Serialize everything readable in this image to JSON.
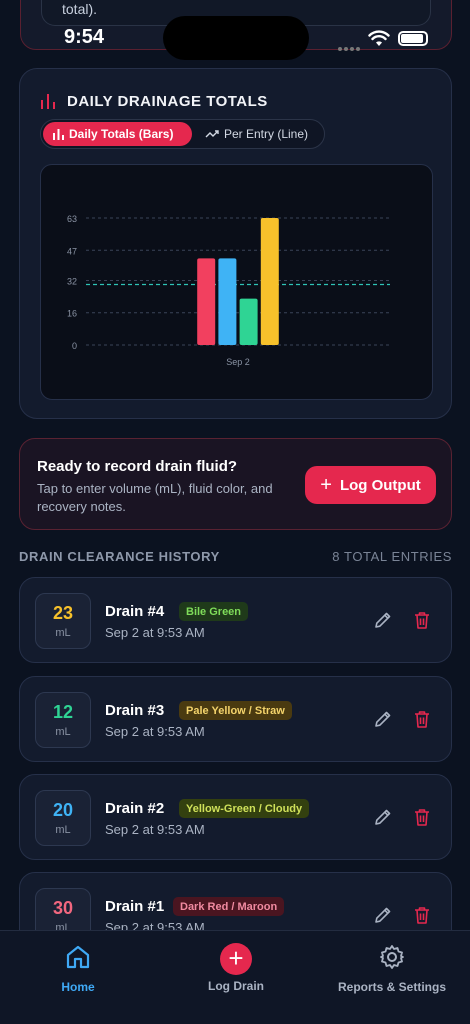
{
  "prev_card": {
    "text": "total)."
  },
  "status_bar": {
    "time": "9:54"
  },
  "chart_card": {
    "title": "DAILY DRAINAGE TOTALS",
    "toggle_bars": "Daily Totals (Bars)",
    "toggle_line": "Per Entry (Line)"
  },
  "chart_data": {
    "type": "bar",
    "categories": [
      "Sep 2"
    ],
    "series": [
      {
        "values": [
          43
        ],
        "color": "#f2405f"
      },
      {
        "values": [
          43
        ],
        "color": "#3fb3f5"
      },
      {
        "values": [
          23
        ],
        "color": "#2fd494"
      },
      {
        "values": [
          63
        ],
        "color": "#f7c12b"
      }
    ],
    "yticks": [
      "0",
      "16",
      "32",
      "47",
      "63"
    ],
    "ylim": [
      0,
      63
    ],
    "reference_line": 30,
    "reference_color": "#2ec4b6",
    "grid": true
  },
  "record_card": {
    "title": "Ready to record drain fluid?",
    "subtitle": "Tap to enter volume (mL), fluid color, and recovery notes.",
    "button_label": "Log Output"
  },
  "history": {
    "title": "DRAIN CLEARANCE HISTORY",
    "count": "8 TOTAL ENTRIES",
    "entries": [
      {
        "volume": "23",
        "unit": "mL",
        "name": "Drain #4",
        "badge": "Bile Green",
        "badge_bg": "#1f3a1a",
        "badge_fg": "#7fdc5a",
        "vol_color": "#f7c12b",
        "time": "Sep 2 at 9:53 AM"
      },
      {
        "volume": "12",
        "unit": "mL",
        "name": "Drain #3",
        "badge": "Pale Yellow / Straw",
        "badge_bg": "#4a3a10",
        "badge_fg": "#f3d36b",
        "vol_color": "#2fd494",
        "time": "Sep 2 at 9:53 AM"
      },
      {
        "volume": "20",
        "unit": "mL",
        "name": "Drain #2",
        "badge": "Yellow-Green / Cloudy",
        "badge_bg": "#33400f",
        "badge_fg": "#cfe05a",
        "vol_color": "#3fb3f5",
        "time": "Sep 2 at 9:53 AM"
      },
      {
        "volume": "30",
        "unit": "mL",
        "name": "Drain #1",
        "badge": "Dark Red / Maroon",
        "badge_bg": "#4a1520",
        "badge_fg": "#f08aa0",
        "vol_color": "#f2677f",
        "time": "Sep 2 at 9:53 AM"
      }
    ]
  },
  "tabbar": {
    "home": "Home",
    "log": "Log Drain",
    "reports": "Reports & Settings"
  },
  "colors": {
    "accent": "#e5284e",
    "active_tab": "#3fa9f5",
    "background": "#0b1220"
  }
}
